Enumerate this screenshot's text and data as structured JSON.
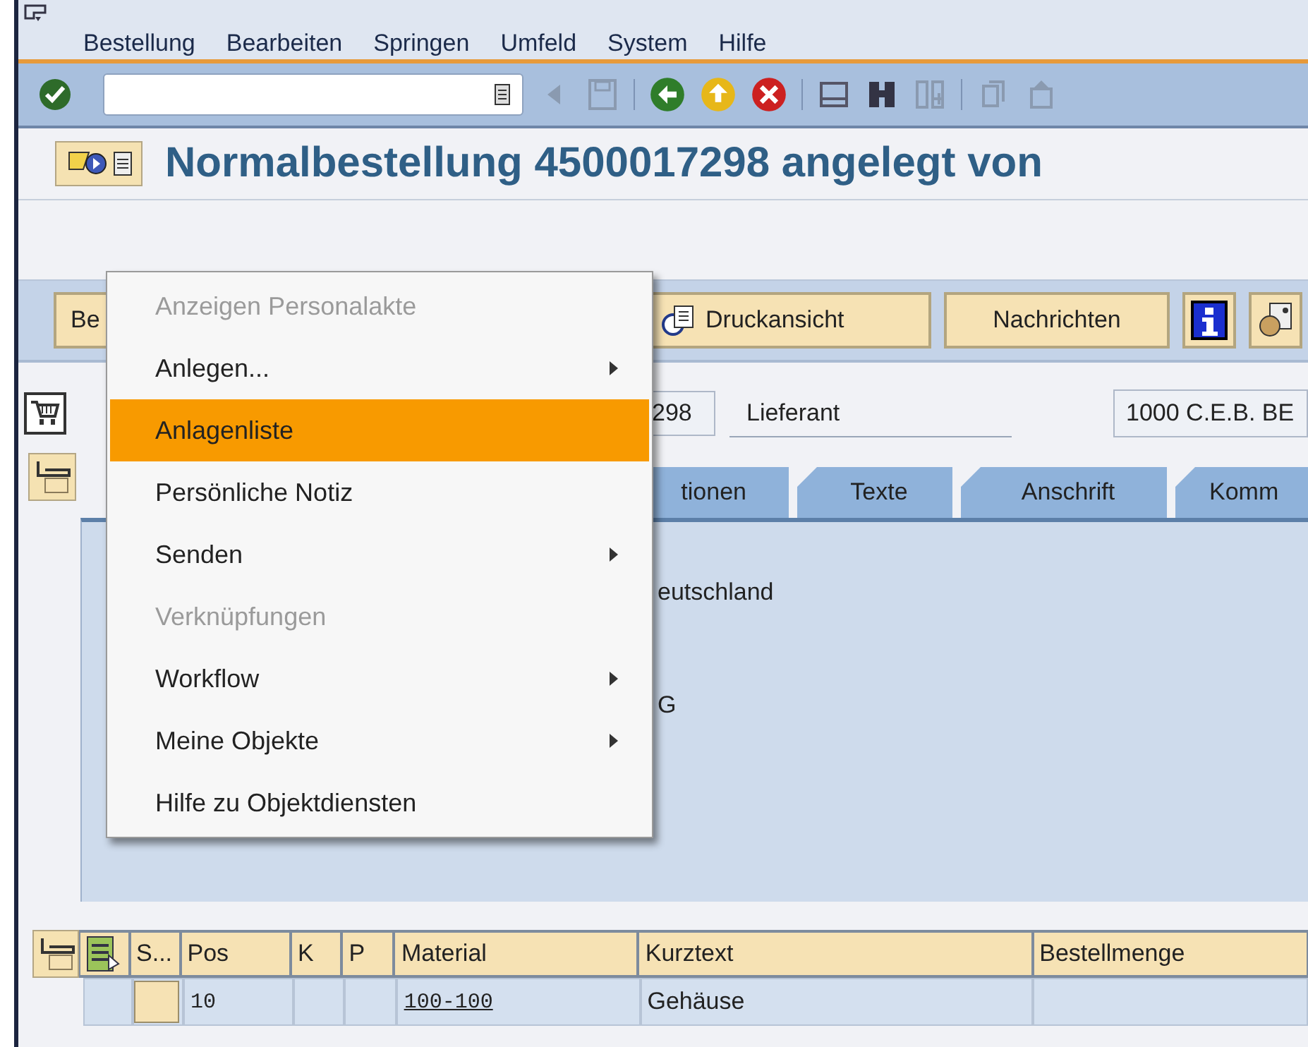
{
  "menu_bar": [
    {
      "label": "Bestellung"
    },
    {
      "label": "Bearbeiten"
    },
    {
      "label": "Springen"
    },
    {
      "label": "Umfeld"
    },
    {
      "label": "System"
    },
    {
      "label": "Hilfe"
    }
  ],
  "title": "Normalbestellung 4500017298 angelegt von",
  "app_toolbar": {
    "buttons": [
      {
        "label": "Be"
      },
      {
        "label": "Druckansicht"
      },
      {
        "label": "Nachrichten"
      }
    ]
  },
  "header": {
    "number_field": "298",
    "vendor_label": "Lieferant",
    "vendor_field": "1000 C.E.B. BE"
  },
  "tabs": [
    "tionen",
    "Texte",
    "Anschrift",
    "Komm"
  ],
  "tab_content": [
    "eutschland",
    "G"
  ],
  "table": {
    "columns": [
      {
        "label": "S...",
        "kind": "status"
      },
      {
        "label": "Pos",
        "kind": "number"
      },
      {
        "label": "K",
        "kind": "text"
      },
      {
        "label": "P",
        "kind": "text"
      },
      {
        "label": "Material",
        "kind": "link"
      },
      {
        "label": "Kurztext",
        "kind": "text"
      },
      {
        "label": "Bestellmenge",
        "kind": "text"
      }
    ],
    "rows": [
      {
        "cells": [
          null,
          "10",
          null,
          null,
          "100-100",
          "Gehäuse",
          null
        ]
      }
    ]
  },
  "context_menu": [
    {
      "label": "Anzeigen Personalakte",
      "disabled": true,
      "selected": false,
      "submenu": false
    },
    {
      "label": "Anlegen...",
      "disabled": false,
      "selected": false,
      "submenu": true
    },
    {
      "label": "Anlagenliste",
      "disabled": false,
      "selected": true,
      "submenu": false
    },
    {
      "label": "Persönliche Notiz",
      "disabled": false,
      "selected": false,
      "submenu": false
    },
    {
      "label": "Senden",
      "disabled": false,
      "selected": false,
      "submenu": true
    },
    {
      "label": "Verknüpfungen",
      "disabled": true,
      "selected": false,
      "submenu": false
    },
    {
      "label": "Workflow",
      "disabled": false,
      "selected": false,
      "submenu": true
    },
    {
      "label": "Meine Objekte",
      "disabled": false,
      "selected": false,
      "submenu": true
    },
    {
      "label": "Hilfe zu Objektdiensten",
      "disabled": false,
      "selected": false,
      "submenu": false
    }
  ]
}
